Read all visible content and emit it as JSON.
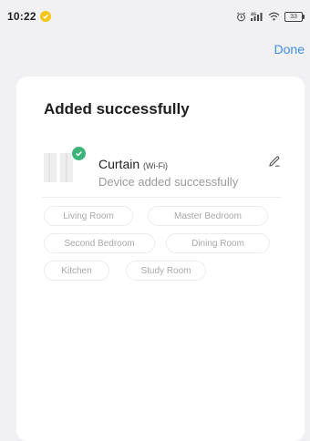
{
  "status_bar": {
    "time": "10:22",
    "battery_level": "33"
  },
  "header": {
    "done_label": "Done"
  },
  "card": {
    "title": "Added successfully",
    "device": {
      "name": "Curtain",
      "connection": "(Wi-Fi)",
      "status": "Device added successfully"
    },
    "rooms": [
      {
        "label": "Living Room"
      },
      {
        "label": "Master Bedroom"
      },
      {
        "label": "Second Bedroom"
      },
      {
        "label": "Dining Room"
      },
      {
        "label": "Kitchen"
      },
      {
        "label": "Study Room"
      }
    ]
  },
  "colors": {
    "accent": "#3d8ff0",
    "success": "#3bb37a",
    "background": "#f1f1f3",
    "card": "#ffffff"
  },
  "icons": {
    "notification": "notification-badge-icon",
    "alarm": "alarm-icon",
    "signal": "signal-icon",
    "wifi": "wifi-icon",
    "battery": "battery-icon",
    "device": "curtain-icon",
    "check": "check-icon",
    "edit": "edit-pencil-icon"
  }
}
